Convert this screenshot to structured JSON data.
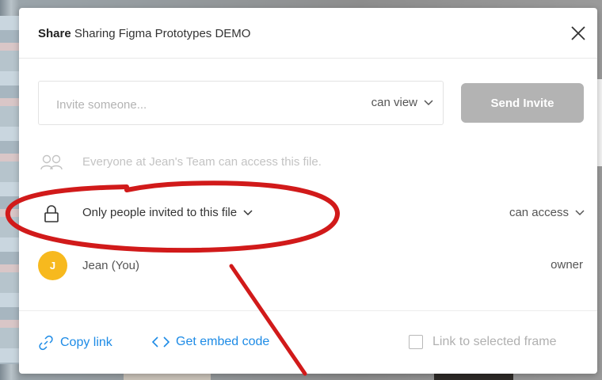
{
  "dialog": {
    "title_prefix": "Share",
    "title_file": "Sharing Figma Prototypes DEMO"
  },
  "invite": {
    "placeholder": "Invite someone...",
    "permission": "can view",
    "send_label": "Send Invite"
  },
  "team_row": {
    "text": "Everyone at Jean's Team can access this file."
  },
  "access_row": {
    "scope": "Only people invited to this file",
    "permission": "can access"
  },
  "member": {
    "initial": "J",
    "name": "Jean (You)",
    "role": "owner"
  },
  "footer": {
    "copy_link": "Copy link",
    "embed_code": "Get embed code",
    "link_frame": "Link to selected frame"
  },
  "colors": {
    "link_blue": "#1d8be6",
    "avatar_yellow": "#f7b91e",
    "annotation_red": "#d11a1a",
    "disabled_button": "#b3b3b3"
  },
  "icons": [
    "close-icon",
    "chevron-down-icon",
    "team-icon",
    "lock-icon",
    "link-icon",
    "code-icon",
    "checkbox-icon"
  ]
}
